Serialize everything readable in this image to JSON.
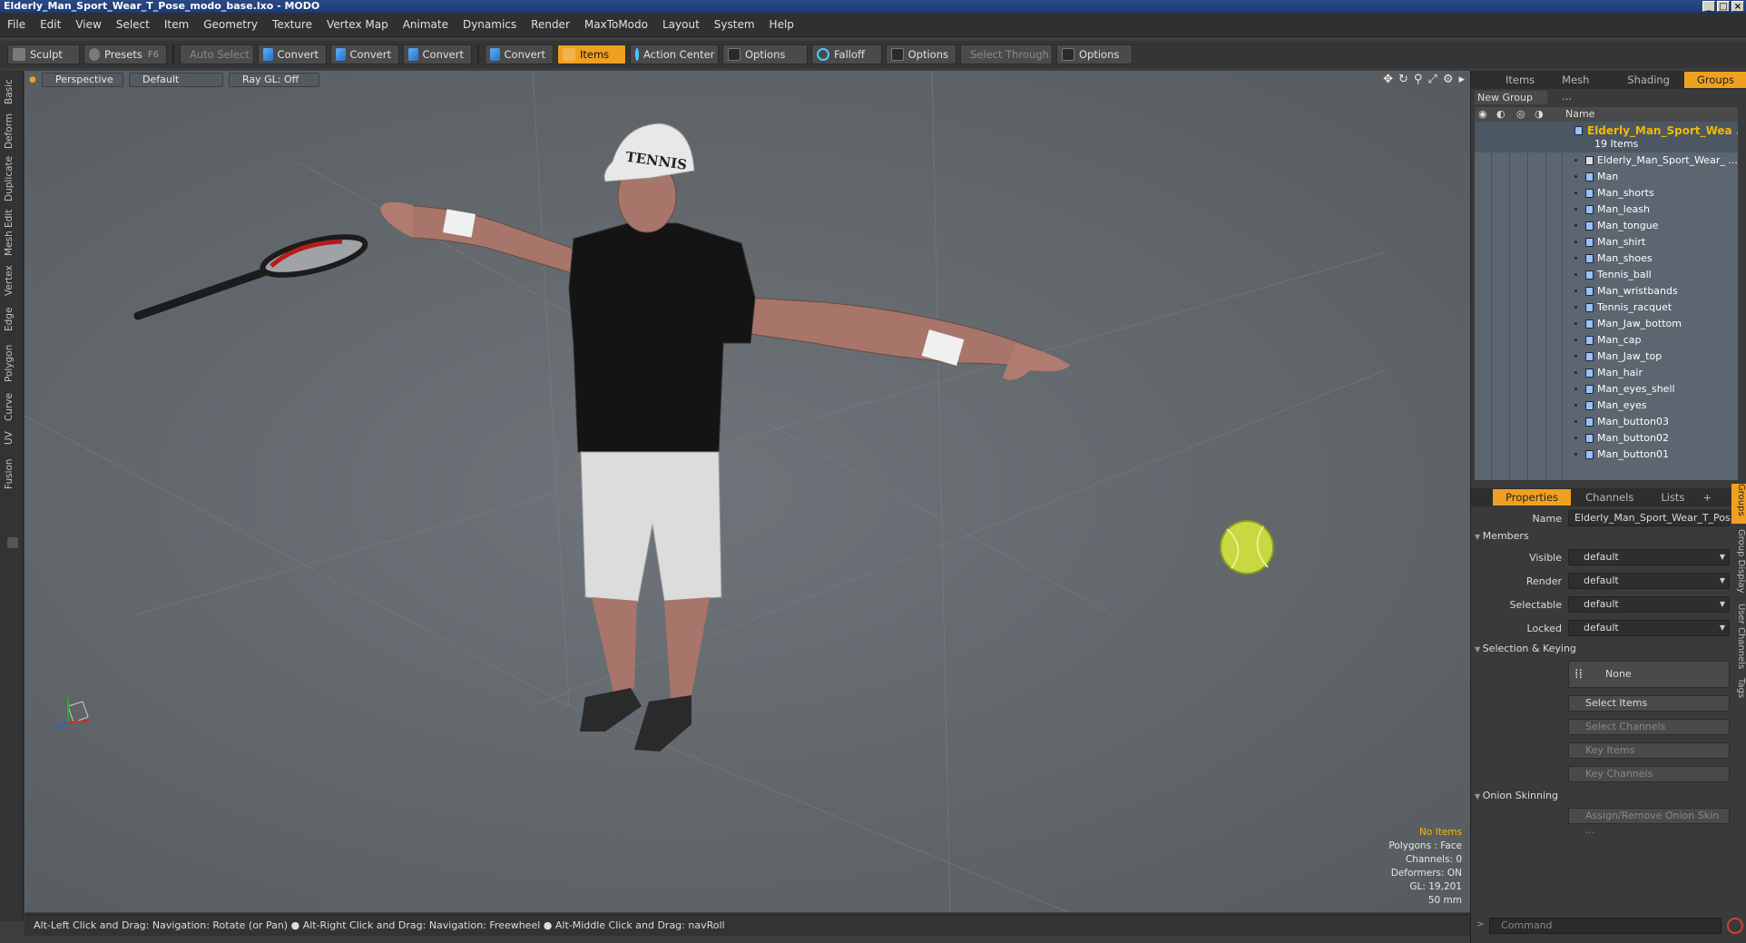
{
  "window": {
    "title": "Elderly_Man_Sport_Wear_T_Pose_modo_base.lxo - MODO",
    "controls": [
      "_",
      "□",
      "×"
    ]
  },
  "menu": [
    "File",
    "Edit",
    "View",
    "Select",
    "Item",
    "Geometry",
    "Texture",
    "Vertex Map",
    "Animate",
    "Dynamics",
    "Render",
    "MaxToModo",
    "Layout",
    "System",
    "Help"
  ],
  "toolbar": {
    "sculpt": "Sculpt",
    "presets": "Presets",
    "presets_key": "F6",
    "auto_select": "Auto Select",
    "convert1": "Convert",
    "convert2": "Convert",
    "convert3": "Convert",
    "convert4": "Convert",
    "items": "Items",
    "action_center": "Action Center",
    "options1": "Options",
    "falloff": "Falloff",
    "options2": "Options",
    "select_through": "Select Through",
    "options3": "Options"
  },
  "left_tabs": [
    "Basic",
    "Deform",
    "Duplicate",
    "Mesh Edit",
    "Vertex",
    "Edge",
    "Polygon",
    "Curve",
    "UV",
    "Fusion"
  ],
  "viewport": {
    "view": "Perspective",
    "shading": "Default",
    "raygl": "Ray GL: Off",
    "cap_text": "TENNIS",
    "info": {
      "selection": "No Items",
      "polygons": "Polygons : Face",
      "channels": "Channels: 0",
      "deformers": "Deformers: ON",
      "gl": "GL: 19,201",
      "focal": "50 mm"
    }
  },
  "status": "Alt-Left Click and Drag: Navigation: Rotate (or Pan) ● Alt-Right Click and Drag: Navigation: Freewheel ● Alt-Middle Click and Drag: navRoll",
  "top_tabs": [
    "Items",
    "Mesh ...",
    "Shading",
    "Groups"
  ],
  "groups": {
    "new_group": "New Group",
    "name_header": "Name",
    "root_name": "Elderly_Man_Sport_Wea ...",
    "root_count": "19 Items",
    "items": [
      "Elderly_Man_Sport_Wear_ ...",
      "Man",
      "Man_shorts",
      "Man_leash",
      "Man_tongue",
      "Man_shirt",
      "Man_shoes",
      "Tennis_ball",
      "Man_wristbands",
      "Tennis_racquet",
      "Man_Jaw_bottom",
      "Man_cap",
      "Man_Jaw_top",
      "Man_hair",
      "Man_eyes_shell",
      "Man_eyes",
      "Man_button03",
      "Man_button02",
      "Man_button01"
    ]
  },
  "bottom_tabs": [
    "Properties",
    "Channels",
    "Lists",
    "+"
  ],
  "properties": {
    "name_label": "Name",
    "name_value": "Elderly_Man_Sport_Wear_T_Pos",
    "members": "Members",
    "visible_label": "Visible",
    "visible_value": "default",
    "render_label": "Render",
    "render_value": "default",
    "selectable_label": "Selectable",
    "selectable_value": "default",
    "locked_label": "Locked",
    "locked_value": "default",
    "selection_keying": "Selection & Keying",
    "none": "None",
    "select_items": "Select Items",
    "select_channels": "Select Channels",
    "key_items": "Key Items",
    "key_channels": "Key Channels",
    "onion": "Onion Skinning",
    "assign_onion": "Assign/Remove Onion Skin ..."
  },
  "right_vtabs": [
    "Groups",
    "Group Display",
    "User Channels",
    "Tags"
  ],
  "command_placeholder": "Command",
  "colors": {
    "accent": "#f0a020",
    "viewport": "#62686c",
    "selected": "#f5b800"
  }
}
